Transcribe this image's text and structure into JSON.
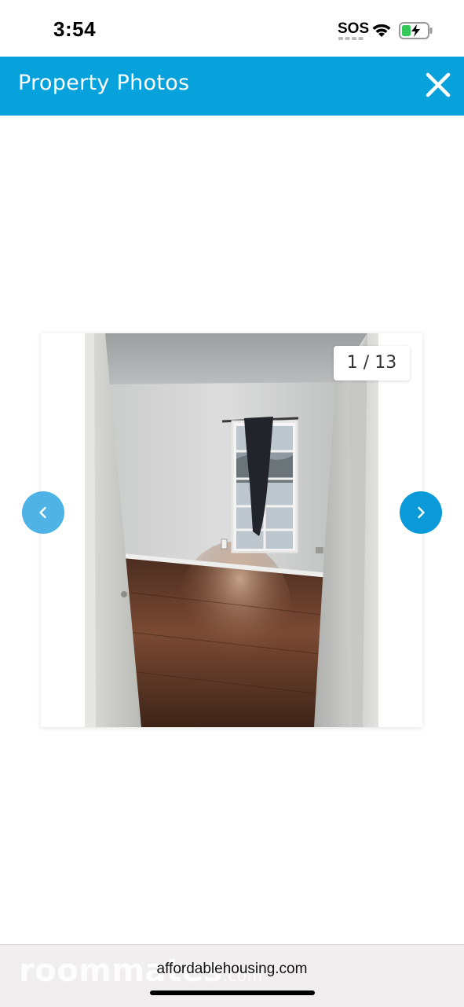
{
  "status_bar": {
    "time": "3:54",
    "carrier": "SOS",
    "icons": [
      "wifi-icon",
      "battery-charging-icon"
    ]
  },
  "header": {
    "title": "Property Photos",
    "close_icon": "close-icon",
    "background_color": "#07a1dc"
  },
  "gallery": {
    "counter": "1 / 13",
    "current_index": 1,
    "total": 13,
    "prev_icon": "chevron-left-icon",
    "next_icon": "chevron-right-icon",
    "photo_subject": "empty-bedroom-photo"
  },
  "browser": {
    "url": "affordablehousing.com",
    "watermark": "roommates",
    "watermark_suffix": ".com"
  }
}
